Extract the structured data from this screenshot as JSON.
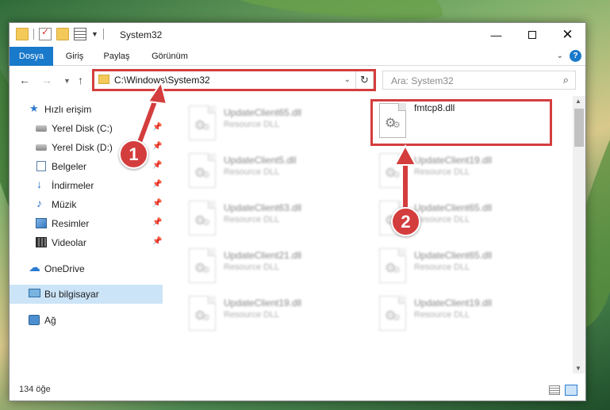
{
  "window": {
    "title": "System32",
    "controls": {
      "minimize": "—",
      "close": "✕"
    }
  },
  "ribbon": {
    "tabs": [
      "Dosya",
      "Giriş",
      "Paylaş",
      "Görünüm"
    ],
    "help": "?"
  },
  "nav": {
    "address": "C:\\Windows\\System32",
    "search_placeholder": "Ara: System32"
  },
  "sidebar": {
    "items": [
      {
        "label": "Hızlı erişim",
        "icon": "star-icon",
        "pinned": false
      },
      {
        "label": "Yerel Disk (C:)",
        "icon": "drive-icon",
        "pinned": true
      },
      {
        "label": "Yerel Disk (D:)",
        "icon": "drive-icon",
        "pinned": true
      },
      {
        "label": "Belgeler",
        "icon": "document-icon",
        "pinned": true
      },
      {
        "label": "İndirmeler",
        "icon": "download-icon",
        "pinned": true
      },
      {
        "label": "Müzik",
        "icon": "music-icon",
        "pinned": true
      },
      {
        "label": "Resimler",
        "icon": "pictures-icon",
        "pinned": true
      },
      {
        "label": "Videolar",
        "icon": "video-icon",
        "pinned": true
      },
      {
        "label": "OneDrive",
        "icon": "cloud-icon",
        "pinned": false
      },
      {
        "label": "Bu bilgisayar",
        "icon": "computer-icon",
        "pinned": false,
        "selected": true
      },
      {
        "label": "Ağ",
        "icon": "network-icon",
        "pinned": false
      }
    ]
  },
  "files": [
    {
      "name": "UpdateClient65.dll",
      "type": "Resource DLL"
    },
    {
      "name": "fmtcp8.dll",
      "type": ""
    },
    {
      "name": "UpdateClient5.dll",
      "type": "Resource DLL"
    },
    {
      "name": "UpdateClient19.dll",
      "type": "Resource DLL"
    },
    {
      "name": "UpdateClient63.dll",
      "type": "Resource DLL"
    },
    {
      "name": "UpdateClient65.dll",
      "type": "Resource DLL"
    },
    {
      "name": "UpdateClient21.dll",
      "type": "Resource DLL"
    },
    {
      "name": "UpdateClient65.dll",
      "type": "Resource DLL"
    },
    {
      "name": "UpdateClient19.dll",
      "type": "Resource DLL"
    },
    {
      "name": "UpdateClient19.dll",
      "type": "Resource DLL"
    }
  ],
  "status": {
    "item_count": "134 öğe"
  },
  "annotations": {
    "step1": "1",
    "step2": "2"
  },
  "colors": {
    "accent": "#1979ca",
    "highlight": "#d43d3d",
    "selection": "#cce4f7"
  }
}
